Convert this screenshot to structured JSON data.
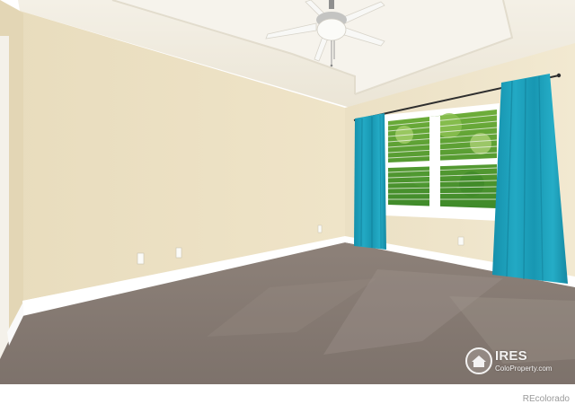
{
  "watermark": {
    "brand": "IRES",
    "tagline": "ColoProperty.com"
  },
  "footer": {
    "credit": "REcolorado"
  },
  "colors": {
    "wall": "#ece0c2",
    "ceiling": "#f1ece0",
    "carpet": "#8c8179",
    "curtain": "#1aa2bd",
    "trim": "#ffffff"
  }
}
